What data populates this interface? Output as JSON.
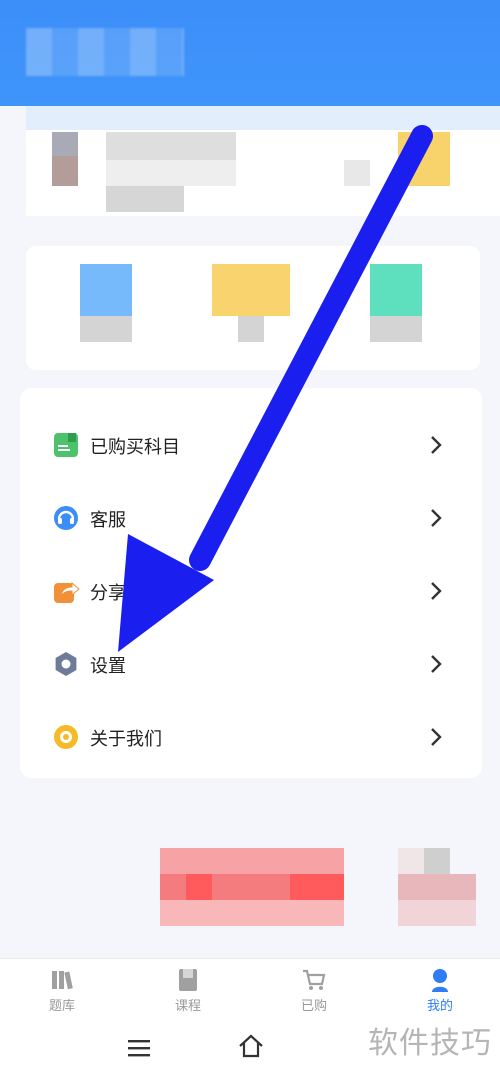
{
  "menu": {
    "items": [
      {
        "label": "已购买科目",
        "icon": "book-icon",
        "color": "#4cc36a"
      },
      {
        "label": "客服",
        "icon": "headset-icon",
        "color": "#3a8ef6"
      },
      {
        "label": "分享",
        "icon": "share-icon",
        "color": "#f0913a"
      },
      {
        "label": "设置",
        "icon": "gear-icon",
        "color": "#6d7b99"
      },
      {
        "label": "关于我们",
        "icon": "info-icon",
        "color": "#f6b928"
      }
    ]
  },
  "bottom_nav": {
    "items": [
      {
        "label": "题库",
        "icon": "books-icon",
        "active": false
      },
      {
        "label": "课程",
        "icon": "course-icon",
        "active": false
      },
      {
        "label": "已购",
        "icon": "cart-icon",
        "active": false
      },
      {
        "label": "我的",
        "icon": "user-icon",
        "active": true
      }
    ]
  },
  "watermark": "软件技巧",
  "colors": {
    "header": "#3f95fb",
    "accent": "#2e7cf6",
    "arrow": "#1a1ff0"
  }
}
